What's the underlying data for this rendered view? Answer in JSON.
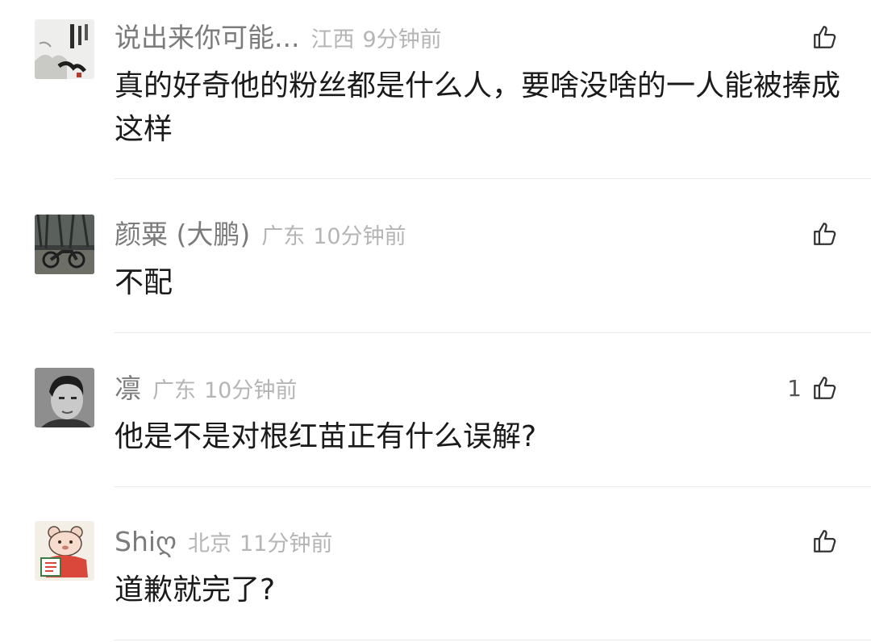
{
  "comments": [
    {
      "username": "说出来你可能...",
      "location": "江西",
      "time": "9分钟前",
      "text": "真的好奇他的粉丝都是什么人，要啥没啥的一人能被捧成这样",
      "like_count": "",
      "avatar_icon": "calligraphy-avatar"
    },
    {
      "username": "颜粟 (大鹏)",
      "location": "广东",
      "time": "10分钟前",
      "text": "不配",
      "like_count": "",
      "avatar_icon": "motorcycle-photo-avatar"
    },
    {
      "username": "凛",
      "location": "广东",
      "time": "10分钟前",
      "text": "他是不是对根红苗正有什么误解?",
      "like_count": "1",
      "avatar_icon": "portrait-photo-avatar"
    },
    {
      "username": "Shiღ",
      "location": "北京",
      "time": "11分钟前",
      "text": "道歉就完了?",
      "like_count": "",
      "avatar_icon": "cartoon-bear-avatar"
    }
  ],
  "colors": {
    "username": "#7b7b7b",
    "meta": "#b5b5b5",
    "text": "#1a1a1a",
    "divider": "#e9e9e9"
  },
  "icons": {
    "like": "thumbs-up-icon"
  }
}
